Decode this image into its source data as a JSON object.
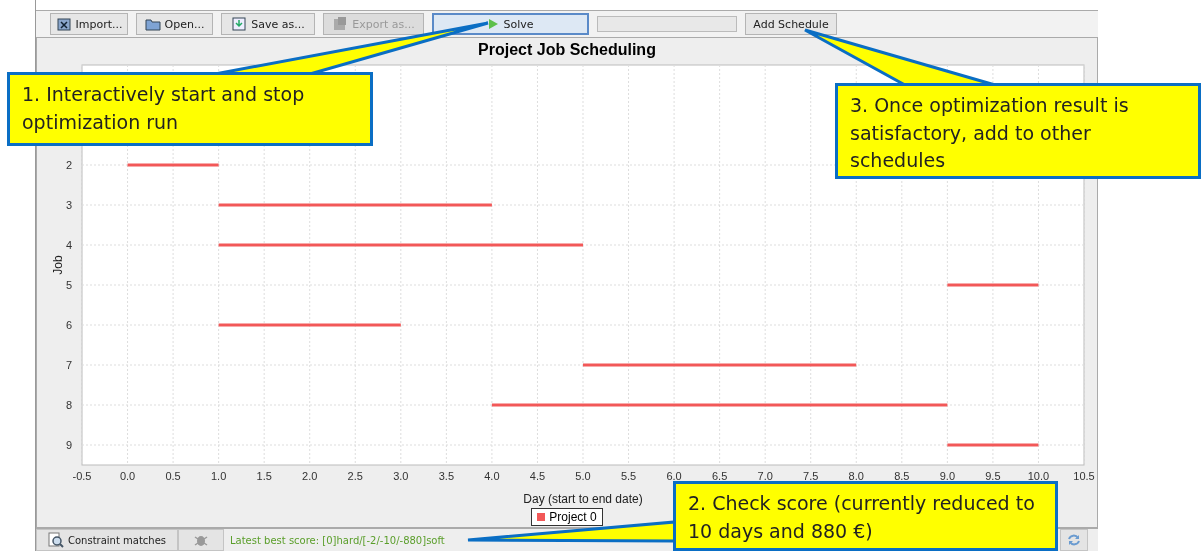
{
  "toolbar": {
    "buttons": [
      {
        "kind": "import",
        "label": "Import...",
        "disabled": false,
        "selected": false
      },
      {
        "kind": "open",
        "label": "Open...",
        "disabled": false,
        "selected": false
      },
      {
        "kind": "save",
        "label": "Save as...",
        "disabled": false,
        "selected": false
      },
      {
        "kind": "export",
        "label": "Export as...",
        "disabled": true,
        "selected": false
      },
      {
        "kind": "solve",
        "label": "Solve",
        "disabled": false,
        "selected": true
      }
    ],
    "add_button": "Add Schedule"
  },
  "chart": {
    "title": "Project Job Scheduling",
    "chart_data": {
      "type": "line",
      "xlabel": "Day (start to end date)",
      "ylabel": "Job",
      "x": [
        0,
        1,
        2,
        3,
        4,
        5,
        6,
        7,
        8,
        9,
        10
      ],
      "grid": true,
      "series": [
        {
          "name": "Project 0",
          "color": "#f25858",
          "values": [
            2,
            2,
            null,
            null,
            null,
            null,
            null,
            null,
            null,
            null,
            null
          ]
        },
        {
          "color": "#f25858",
          "values": [
            null,
            3,
            3,
            3,
            3,
            null,
            null,
            null,
            null,
            null,
            null
          ]
        },
        {
          "color": "#f25858",
          "values": [
            null,
            4,
            4,
            4,
            4,
            4,
            null,
            null,
            null,
            null,
            null
          ]
        },
        {
          "color": "#f25858",
          "values": [
            null,
            null,
            null,
            null,
            null,
            null,
            null,
            null,
            null,
            5,
            5
          ]
        },
        {
          "color": "#f25858",
          "values": [
            null,
            6,
            6,
            6,
            null,
            null,
            null,
            null,
            null,
            null,
            null
          ]
        },
        {
          "color": "#f25858",
          "values": [
            null,
            null,
            null,
            null,
            null,
            7,
            7,
            7,
            7,
            null,
            null
          ]
        },
        {
          "color": "#f25858",
          "values": [
            null,
            null,
            null,
            null,
            8,
            8,
            8,
            8,
            8,
            8,
            null
          ]
        },
        {
          "color": "#f25858",
          "values": [
            null,
            null,
            null,
            null,
            null,
            null,
            null,
            null,
            null,
            9,
            9
          ]
        }
      ],
      "xlim": [
        -0.5,
        10.5
      ],
      "ylim": [
        9.5,
        -0.5
      ],
      "xticks": [
        {
          "value": -0.5,
          "label": "-0.5"
        },
        {
          "value": 0,
          "label": "0.0"
        },
        {
          "value": 0.5,
          "label": "0.5"
        },
        {
          "value": 1,
          "label": "1.0"
        },
        {
          "value": 1.5,
          "label": "1.5"
        },
        {
          "value": 2,
          "label": "2.0"
        },
        {
          "value": 2.5,
          "label": "2.5"
        },
        {
          "value": 3,
          "label": "3.0"
        },
        {
          "value": 3.5,
          "label": "3.5"
        },
        {
          "value": 4,
          "label": "4.0"
        },
        {
          "value": 4.5,
          "label": "4.5"
        },
        {
          "value": 5,
          "label": "5.0"
        },
        {
          "value": 5.5,
          "label": "5.5"
        },
        {
          "value": 6,
          "label": "6.0"
        },
        {
          "value": 6.5,
          "label": "6.5"
        },
        {
          "value": 7,
          "label": "7.0"
        },
        {
          "value": 7.5,
          "label": "7.5"
        },
        {
          "value": 8,
          "label": "8.0"
        },
        {
          "value": 8.5,
          "label": "8.5"
        },
        {
          "value": 9,
          "label": "9.0"
        },
        {
          "value": 9.5,
          "label": "9.5"
        },
        {
          "value": 10,
          "label": "10.0"
        },
        {
          "value": 10.5,
          "label": "10.5"
        }
      ],
      "yticks": [
        2,
        3,
        4,
        5,
        6,
        7,
        8,
        9
      ]
    }
  },
  "status_bar": {
    "constraint_button": "Constraint matches",
    "score": "Latest best score: [0]hard/[-2/-10/-880]soft"
  },
  "callouts": [
    {
      "text": "1. Interactively start and stop optimization run"
    },
    {
      "text": "3. Once optimization result is satisfactory, add to other schedules"
    },
    {
      "text": "2. Check score (currently reduced to 10 days and 880 €)"
    }
  ]
}
